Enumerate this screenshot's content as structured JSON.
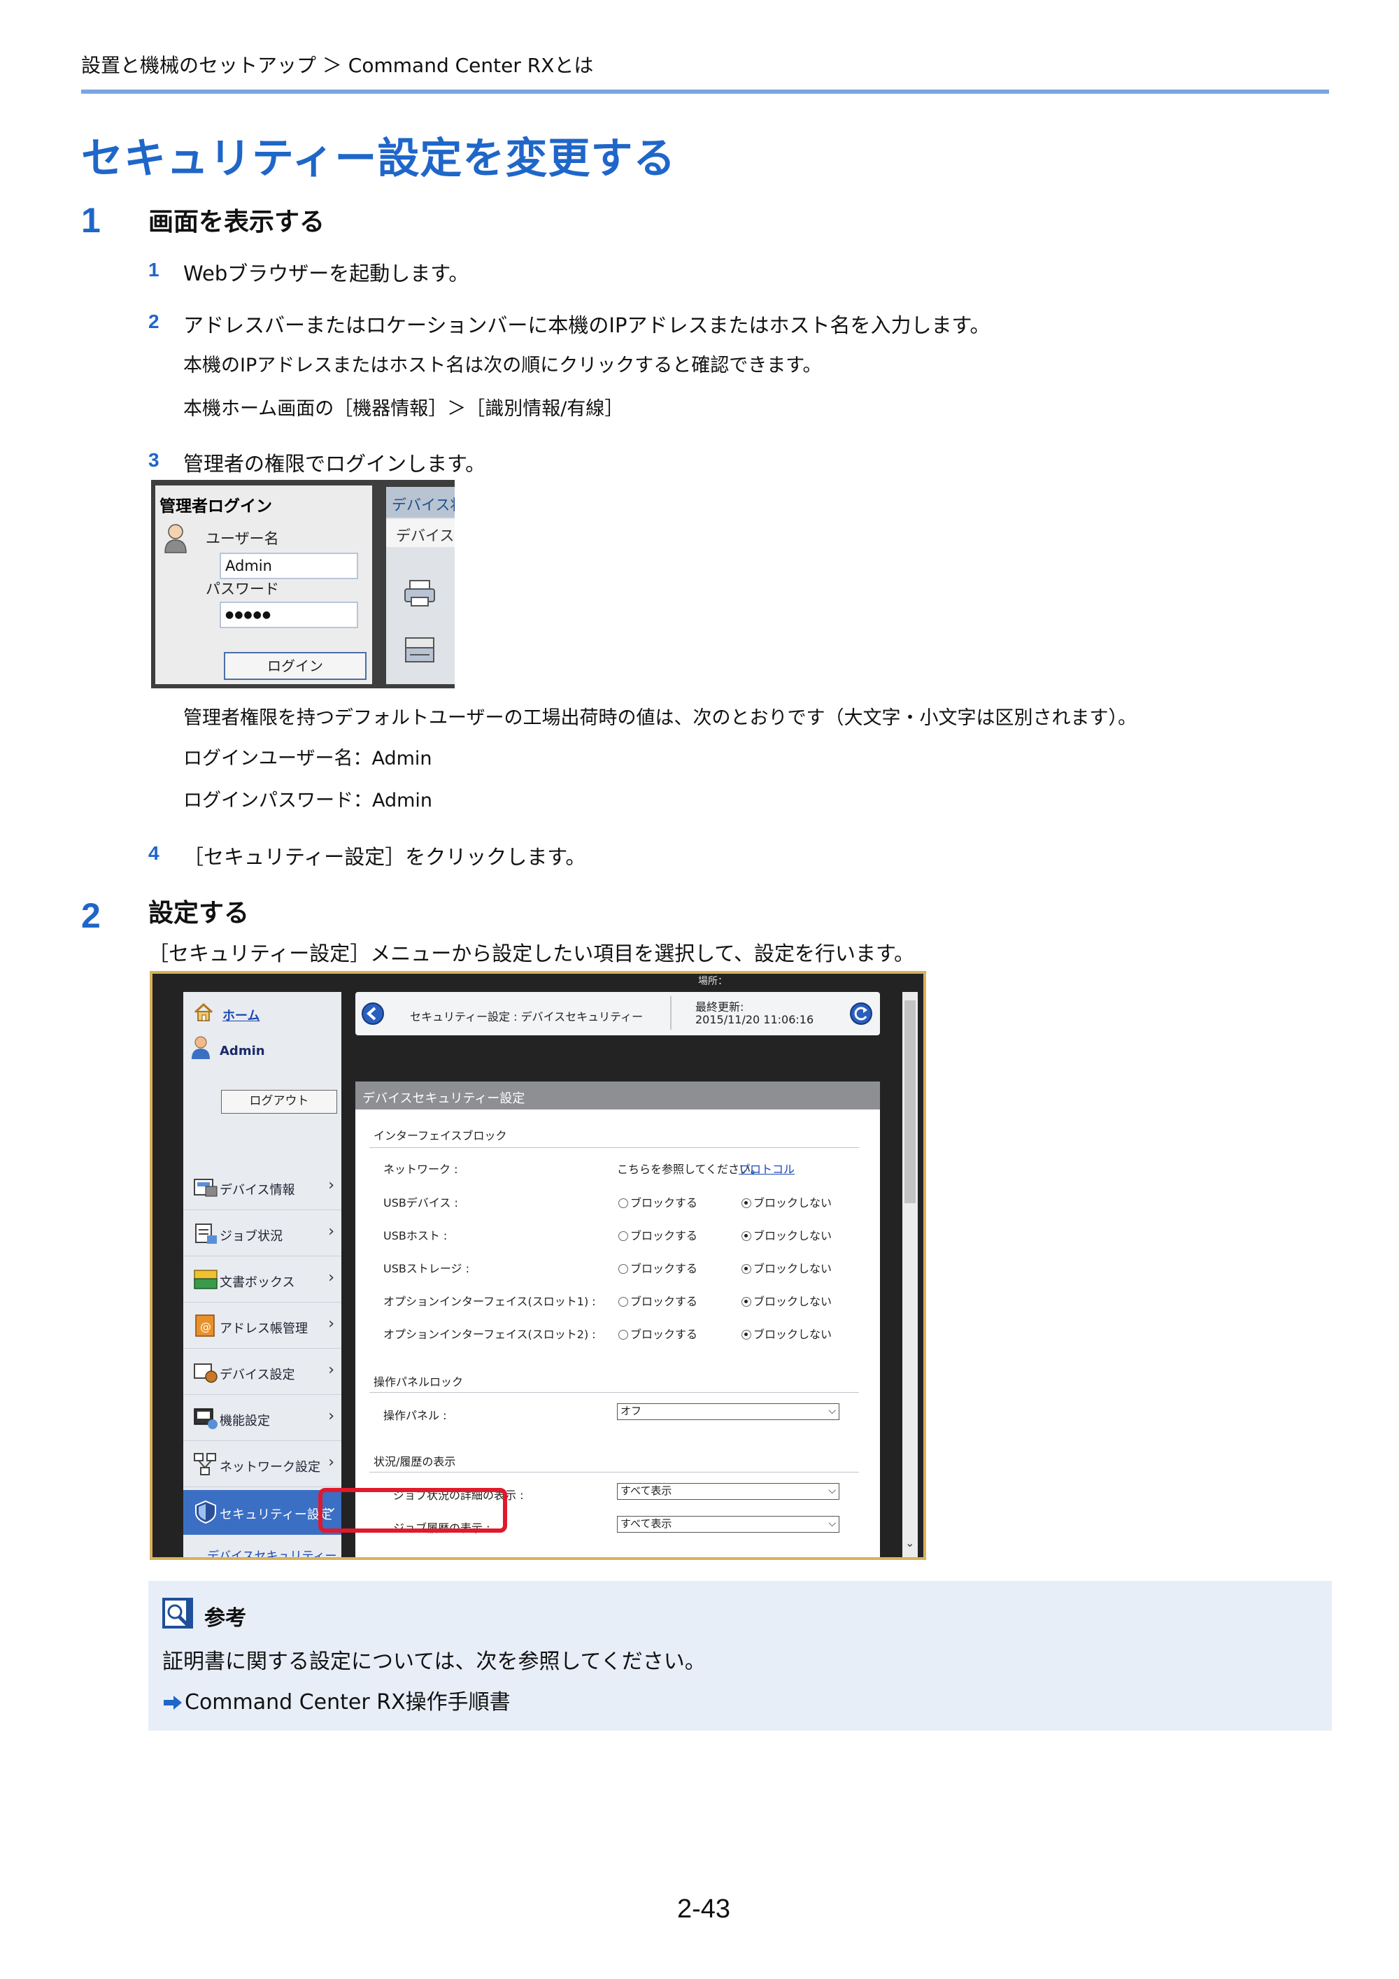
{
  "header": {
    "breadcrumb": "設置と機械のセットアップ ＞ Command Center RXとは",
    "title": "セキュリティー設定を変更する"
  },
  "section1": {
    "number": "1",
    "title": "画面を表示する",
    "steps": [
      {
        "num": "1",
        "text": "Webブラウザーを起動します。"
      },
      {
        "num": "2",
        "text": "アドレスバーまたはロケーションバーに本機のIPアドレスまたはホスト名を入力します。"
      },
      {
        "num": "3",
        "text": "管理者の権限でログインします。"
      },
      {
        "num": "4",
        "text": "［セキュリティー設定］をクリックします。"
      }
    ],
    "step2_note1": "本機のIPアドレスまたはホスト名は次の順にクリックすると確認できます。",
    "step2_note2": "本機ホーム画面の［機器情報］＞［識別情報/有線］",
    "step3_note1": "管理者権限を持つデフォルトユーザーの工場出荷時の値は、次のとおりです（大文字・小文字は区別されます）。",
    "step3_note2": "ログインユーザー名：Admin",
    "step3_note3": "ログインパスワード：Admin"
  },
  "login_screenshot": {
    "title": "管理者ログイン",
    "username_label": "ユーザー名",
    "username_value": "Admin",
    "password_label": "パスワード",
    "password_value": "●●●●●",
    "login_button": "ログイン",
    "right_tab": "デバイス状",
    "right_sub": "デバイス"
  },
  "section2": {
    "number": "2",
    "title": "設定する",
    "text": "［セキュリティー設定］メニューから設定したい項目を選択して、設定を行います。"
  },
  "security_screenshot": {
    "top_location": "場所：",
    "home": "ホーム",
    "user": "Admin",
    "logout": "ログアウト",
    "breadcrumb": "セキュリティー設定 : デバイスセキュリティー",
    "last_update_label": "最終更新:",
    "last_update_value": "2015/11/20 11:06:16",
    "content_header": "デバイスセキュリティー設定",
    "sidebar": [
      {
        "label": "デバイス情報",
        "icon": "device-info-icon"
      },
      {
        "label": "ジョブ状況",
        "icon": "job-status-icon"
      },
      {
        "label": "文書ボックス",
        "icon": "document-box-icon"
      },
      {
        "label": "アドレス帳管理",
        "icon": "address-book-icon"
      },
      {
        "label": "デバイス設定",
        "icon": "device-settings-icon"
      },
      {
        "label": "機能設定",
        "icon": "function-settings-icon"
      },
      {
        "label": "ネットワーク設定",
        "icon": "network-settings-icon"
      },
      {
        "label": "セキュリティー設定",
        "icon": "security-shield-icon"
      }
    ],
    "sidebar_sub": "デバイスセキュリティー",
    "interface_block": {
      "heading": "インターフェイスブロック",
      "network_label": "ネットワーク :",
      "network_text": "こちらを参照してください。",
      "network_link": "プロトコル",
      "rows": [
        {
          "label": "USBデバイス :",
          "opt_block": "ブロックする",
          "opt_noblock": "ブロックしない"
        },
        {
          "label": "USBホスト :",
          "opt_block": "ブロックする",
          "opt_noblock": "ブロックしない"
        },
        {
          "label": "USBストレージ :",
          "opt_block": "ブロックする",
          "opt_noblock": "ブロックしない"
        },
        {
          "label": "オプションインターフェイス(スロット1) :",
          "opt_block": "ブロックする",
          "opt_noblock": "ブロックしない"
        },
        {
          "label": "オプションインターフェイス(スロット2) :",
          "opt_block": "ブロックする",
          "opt_noblock": "ブロックしない"
        }
      ]
    },
    "panel_lock": {
      "heading": "操作パネルロック",
      "label": "操作パネル :",
      "value": "オフ"
    },
    "status_history": {
      "heading": "状況/履歴の表示",
      "job_detail_label": "ジョブ状況の詳細の表示 :",
      "job_detail_value": "すべて表示",
      "job_log_label": "ジョブ履歴の表示 :",
      "job_log_value": "すべて表示"
    }
  },
  "note": {
    "title": "参考",
    "text": "証明書に関する設定については、次を参照してください。",
    "link": "Command Center RX操作手順書"
  },
  "page_number": "2-43",
  "colors": {
    "accent": "#1f66c9",
    "rule": "#7aa6e0",
    "note_bg": "#e8eef8",
    "highlight": "#e0192b"
  }
}
